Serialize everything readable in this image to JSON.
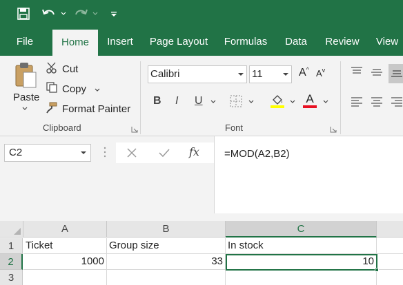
{
  "colors": {
    "accent": "#217346",
    "ribbon_bg": "#f3f3f3",
    "font_color_underline": "#e81123",
    "highlight_underline": "#ffff00"
  },
  "qat": {
    "items": [
      "save-icon",
      "undo-icon",
      "redo-icon",
      "customize-icon"
    ]
  },
  "tabs": [
    {
      "label": "File"
    },
    {
      "label": "Home"
    },
    {
      "label": "Insert"
    },
    {
      "label": "Page Layout"
    },
    {
      "label": "Formulas"
    },
    {
      "label": "Data"
    },
    {
      "label": "Review"
    },
    {
      "label": "View"
    }
  ],
  "clipboard": {
    "paste_label": "Paste",
    "cut_label": "Cut",
    "copy_label": "Copy",
    "format_painter_label": "Format Painter",
    "group_label": "Clipboard"
  },
  "font": {
    "font_name": "Calibri",
    "font_size": "11",
    "bold": "B",
    "italic": "I",
    "underline": "U",
    "increase_size": "A",
    "decrease_size": "A",
    "font_color_letter": "A",
    "group_label": "Font"
  },
  "formula_bar": {
    "name_box": "C2",
    "fx": "fx",
    "formula": "=MOD(A2,B2)"
  },
  "sheet": {
    "columns": [
      "A",
      "B",
      "C"
    ],
    "rows": [
      "1",
      "2",
      "3"
    ],
    "cells": {
      "A1": "Ticket",
      "B1": "Group size",
      "C1": "In stock",
      "A2": "1000",
      "B2": "33",
      "C2": "10"
    },
    "selected_cell": "C2"
  }
}
